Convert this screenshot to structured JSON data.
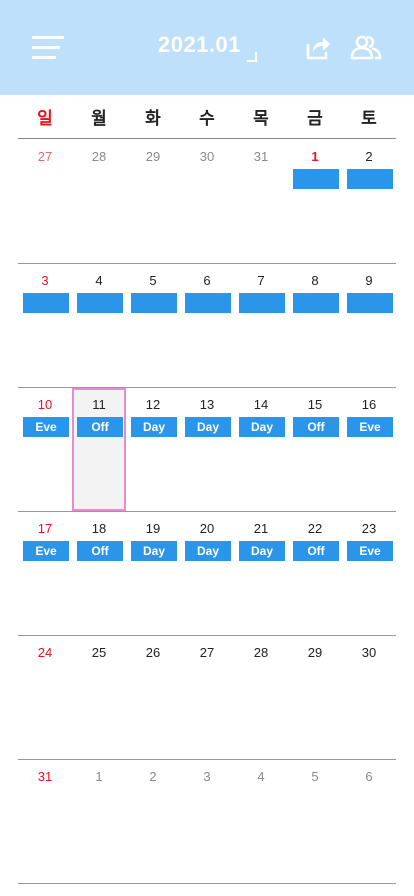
{
  "header": {
    "title": "2021.01",
    "menu_icon": "hamburger-menu-icon",
    "share_icon": "share-icon",
    "users_icon": "users-icon"
  },
  "colors": {
    "header_bg": "#bfe0fb",
    "shift_bg": "#2b95ea",
    "sunday_red": "#e8141a",
    "selected_border": "#ea8ad0"
  },
  "weekdays": [
    "일",
    "월",
    "화",
    "수",
    "목",
    "금",
    "토"
  ],
  "weeks": [
    [
      {
        "day": "27",
        "other": true,
        "shift": null
      },
      {
        "day": "28",
        "other": true,
        "shift": null
      },
      {
        "day": "29",
        "other": true,
        "shift": null
      },
      {
        "day": "30",
        "other": true,
        "shift": null
      },
      {
        "day": "31",
        "other": true,
        "shift": null
      },
      {
        "day": "1",
        "holiday": true,
        "shift": ""
      },
      {
        "day": "2",
        "shift": ""
      }
    ],
    [
      {
        "day": "3",
        "shift": ""
      },
      {
        "day": "4",
        "shift": ""
      },
      {
        "day": "5",
        "shift": ""
      },
      {
        "day": "6",
        "shift": ""
      },
      {
        "day": "7",
        "shift": ""
      },
      {
        "day": "8",
        "shift": ""
      },
      {
        "day": "9",
        "shift": ""
      }
    ],
    [
      {
        "day": "10",
        "shift": "Eve"
      },
      {
        "day": "11",
        "shift": "Off",
        "selected": true
      },
      {
        "day": "12",
        "shift": "Day"
      },
      {
        "day": "13",
        "shift": "Day"
      },
      {
        "day": "14",
        "shift": "Day"
      },
      {
        "day": "15",
        "shift": "Off"
      },
      {
        "day": "16",
        "shift": "Eve"
      }
    ],
    [
      {
        "day": "17",
        "shift": "Eve"
      },
      {
        "day": "18",
        "shift": "Off"
      },
      {
        "day": "19",
        "shift": "Day"
      },
      {
        "day": "20",
        "shift": "Day"
      },
      {
        "day": "21",
        "shift": "Day"
      },
      {
        "day": "22",
        "shift": "Off"
      },
      {
        "day": "23",
        "shift": "Eve"
      }
    ],
    [
      {
        "day": "24",
        "shift": null
      },
      {
        "day": "25",
        "shift": null
      },
      {
        "day": "26",
        "shift": null
      },
      {
        "day": "27",
        "shift": null
      },
      {
        "day": "28",
        "shift": null
      },
      {
        "day": "29",
        "shift": null
      },
      {
        "day": "30",
        "shift": null
      }
    ],
    [
      {
        "day": "31",
        "shift": null
      },
      {
        "day": "1",
        "other": true,
        "shift": null
      },
      {
        "day": "2",
        "other": true,
        "shift": null
      },
      {
        "day": "3",
        "other": true,
        "shift": null
      },
      {
        "day": "4",
        "other": true,
        "shift": null
      },
      {
        "day": "5",
        "other": true,
        "shift": null
      },
      {
        "day": "6",
        "other": true,
        "shift": null
      }
    ]
  ]
}
